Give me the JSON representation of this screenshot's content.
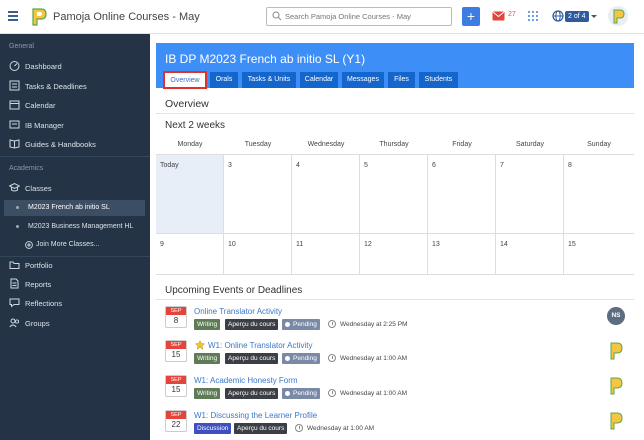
{
  "header": {
    "title": "Pamoja Online Courses - May",
    "search_placeholder": "Search Pamoja Online Courses - May",
    "add_label": "+",
    "mail_count": "27",
    "account_badge": "2 of 4"
  },
  "sidebar": {
    "general_label": "General",
    "general_items": [
      {
        "label": "Dashboard",
        "icon": "speedometer-icon"
      },
      {
        "label": "Tasks & Deadlines",
        "icon": "checklist-icon"
      },
      {
        "label": "Calendar",
        "icon": "calendar-icon"
      },
      {
        "label": "IB Manager",
        "icon": "id-card-icon"
      },
      {
        "label": "Guides & Handbooks",
        "icon": "book-icon"
      }
    ],
    "academics_label": "Academics",
    "classes_label": "Classes",
    "class_items": [
      {
        "label": "M2023 French ab initio SL",
        "active": true
      },
      {
        "label": "M2023 Business Management HL",
        "active": false
      }
    ],
    "join_more_label": "Join More Classes...",
    "other_items": [
      {
        "label": "Portfolio",
        "icon": "folder-icon"
      },
      {
        "label": "Reports",
        "icon": "report-icon"
      },
      {
        "label": "Reflections",
        "icon": "reflection-icon"
      },
      {
        "label": "Groups",
        "icon": "users-icon"
      }
    ]
  },
  "course": {
    "title": "IB DP M2023 French ab initio SL (Y1)",
    "tabs": [
      "Overview",
      "Orals",
      "Tasks & Units",
      "Calendar",
      "Messages",
      "Files",
      "Students"
    ],
    "active_tab": "Overview"
  },
  "overview": {
    "heading": "Overview",
    "next_heading": "Next 2 weeks",
    "weekdays": [
      "Monday",
      "Tuesday",
      "Wednesday",
      "Thursday",
      "Friday",
      "Saturday",
      "Sunday"
    ],
    "week1": [
      "Today",
      "3",
      "4",
      "5",
      "6",
      "7",
      "8"
    ],
    "week2": [
      "9",
      "10",
      "11",
      "12",
      "13",
      "14",
      "15"
    ]
  },
  "upcoming": {
    "heading": "Upcoming Events or Deadlines",
    "events": [
      {
        "month": "SEP",
        "day": "8",
        "title": "Online Translator Activity",
        "tags": [
          "Writing",
          "Aperçu du cours"
        ],
        "status": "Pending",
        "when": "Wednesday at 2:25 PM",
        "starred": false,
        "assignee": "NS"
      },
      {
        "month": "SEP",
        "day": "15",
        "title": "W1: Online Translator Activity",
        "tags": [
          "Writing",
          "Aperçu du cours"
        ],
        "status": "Pending",
        "when": "Wednesday at 1:00 AM",
        "starred": true,
        "assignee": ""
      },
      {
        "month": "SEP",
        "day": "15",
        "title": "W1: Academic Honesty Form",
        "tags": [
          "Writing",
          "Aperçu du cours"
        ],
        "status": "Pending",
        "when": "Wednesday at 1:00 AM",
        "starred": false,
        "assignee": ""
      },
      {
        "month": "SEP",
        "day": "22",
        "title": "W1: Discussing the Learner Profile",
        "tags": [
          "Discussion",
          "Aperçu du cours"
        ],
        "status": "",
        "when": "Wednesday at 1:00 AM",
        "starred": false,
        "assignee": ""
      }
    ]
  },
  "colors": {
    "accent": "#3e8ef7",
    "tab_bg": "#1566cc",
    "sidebar_bg": "#243446",
    "date_red": "#e4443a",
    "highlight": "#e0312d"
  }
}
